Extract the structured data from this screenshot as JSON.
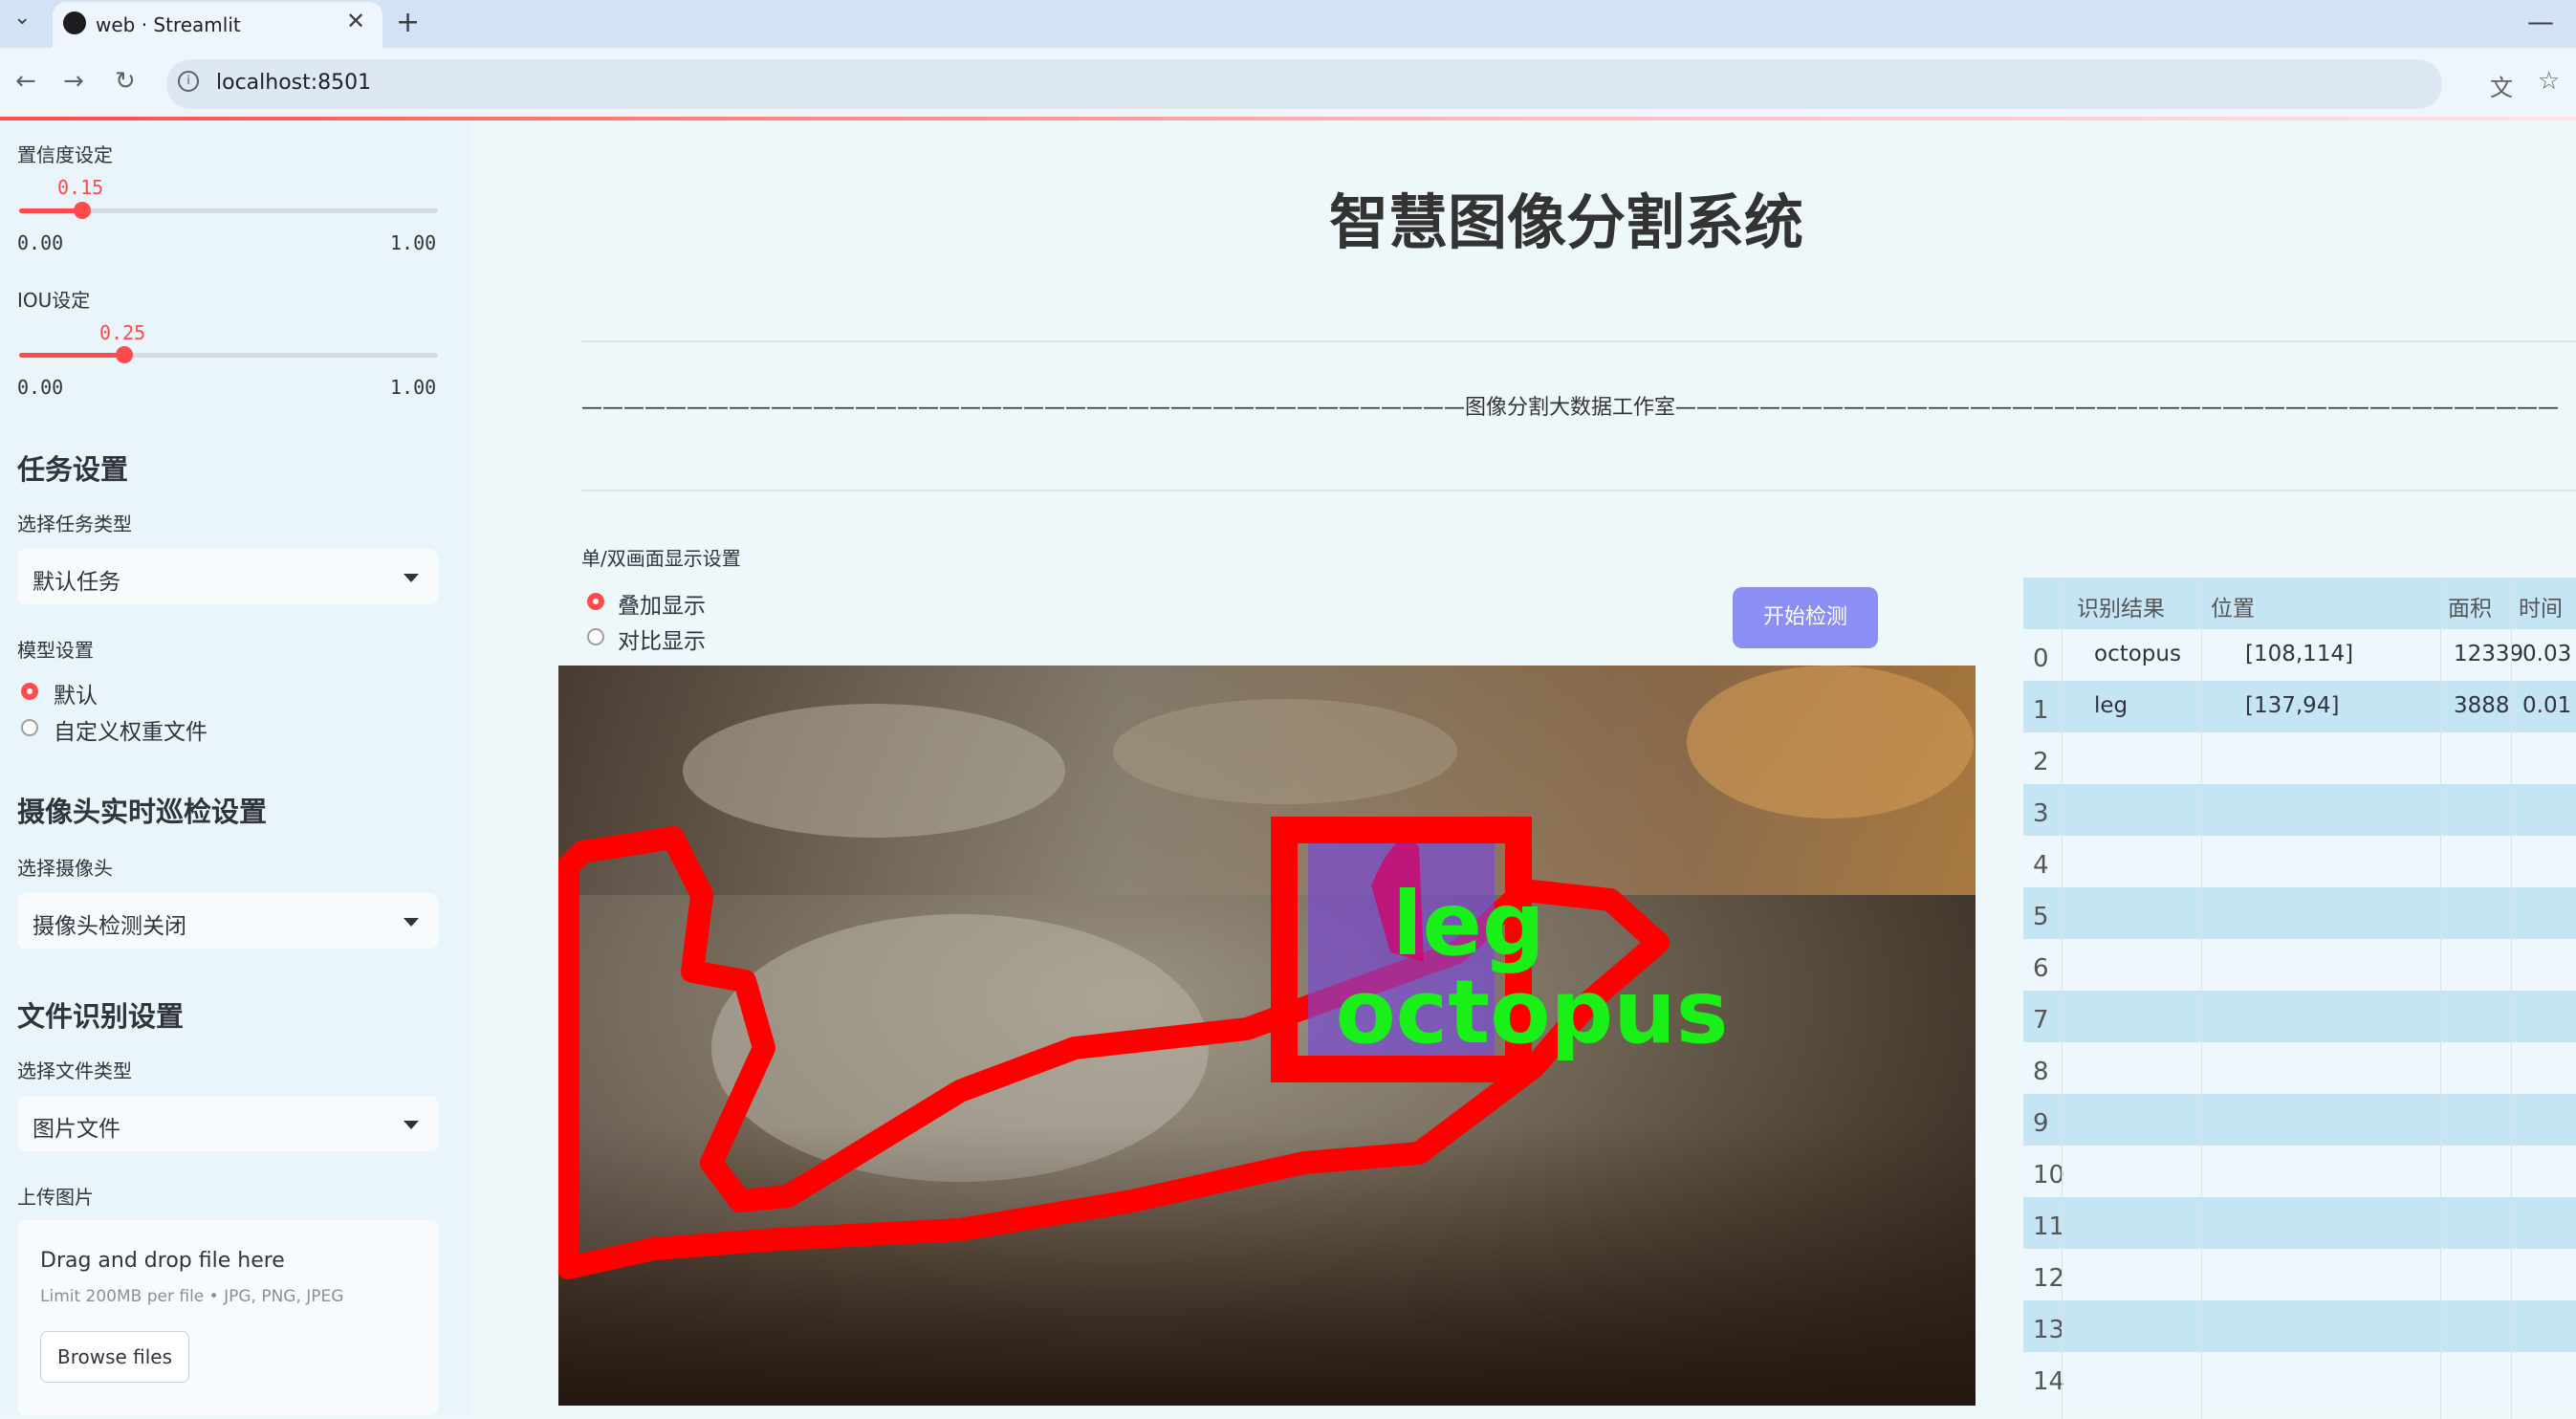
{
  "browser": {
    "tab_title": "web · Streamlit",
    "url": "localhost:8501"
  },
  "sidebar": {
    "confidence": {
      "label": "置信度设定",
      "value": "0.15",
      "min": "0.00",
      "max": "1.00",
      "fraction": 0.15
    },
    "iou": {
      "label": "IOU设定",
      "value": "0.25",
      "min": "0.00",
      "max": "1.00",
      "fraction": 0.25
    },
    "task_section": "任务设置",
    "task_type_label": "选择任务类型",
    "task_type_value": "默认任务",
    "model_label": "模型设置",
    "model_options": [
      "默认",
      "自定义权重文件"
    ],
    "model_selected": 0,
    "camera_section": "摄像头实时巡检设置",
    "camera_label": "选择摄像头",
    "camera_value": "摄像头检测关闭",
    "file_section": "文件识别设置",
    "file_type_label": "选择文件类型",
    "file_type_value": "图片文件",
    "upload_label": "上传图片",
    "dropzone_title": "Drag and drop file here",
    "dropzone_hint": "Limit 200MB per file • JPG, PNG, JPEG",
    "browse_label": "Browse files"
  },
  "main": {
    "title": "智慧图像分割系统",
    "subtitle": "——————————————————————————————————————————图像分割大数据工作室——————————————————————————————————————————",
    "display_label": "单/双画面显示设置",
    "display_options": [
      "叠加显示",
      "对比显示"
    ],
    "display_selected": 0,
    "start_button": "开始检测",
    "image_labels": [
      "leg",
      "octopus"
    ]
  },
  "table": {
    "headers": [
      "识别结果",
      "位置",
      "面积",
      "时间"
    ],
    "rows": [
      {
        "idx": "0",
        "result": "octopus",
        "pos": "[108,114]",
        "area": "12339",
        "time": "0.03"
      },
      {
        "idx": "1",
        "result": "leg",
        "pos": "[137,94]",
        "area": "3888",
        "time": "0.01"
      },
      {
        "idx": "2"
      },
      {
        "idx": "3"
      },
      {
        "idx": "4"
      },
      {
        "idx": "5"
      },
      {
        "idx": "6"
      },
      {
        "idx": "7"
      },
      {
        "idx": "8"
      },
      {
        "idx": "9"
      },
      {
        "idx": "10"
      },
      {
        "idx": "11"
      },
      {
        "idx": "12"
      },
      {
        "idx": "13"
      },
      {
        "idx": "14"
      }
    ]
  },
  "colors": {
    "accent": "#ff4b4b",
    "button": "#8a8ef5",
    "table_stripe": "#c5e5f5"
  }
}
